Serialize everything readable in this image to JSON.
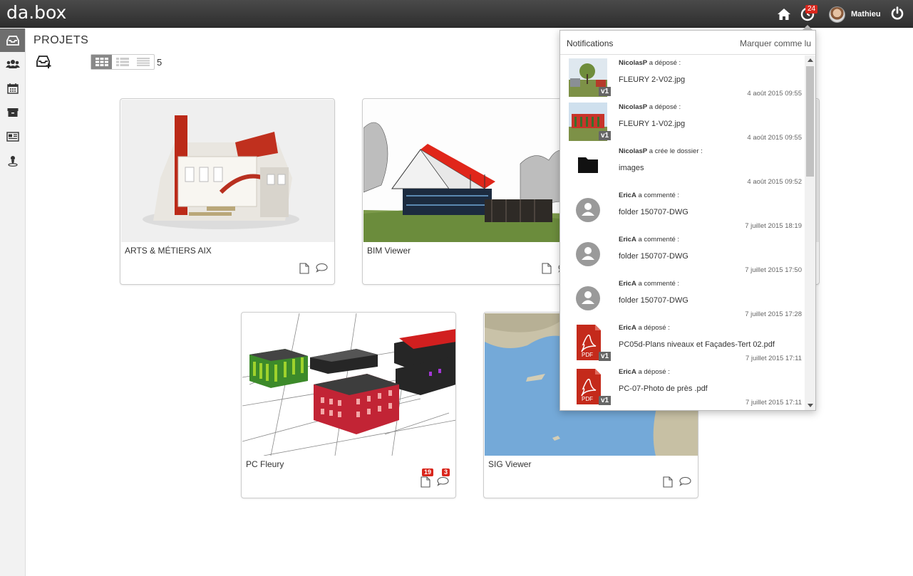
{
  "app": {
    "logo": "da.box"
  },
  "header": {
    "notif_count": "24",
    "username": "Mathieu"
  },
  "sidebar": {
    "items": [
      {
        "name": "projects-icon"
      },
      {
        "name": "users-icon"
      },
      {
        "name": "calendar-icon"
      },
      {
        "name": "archive-icon"
      },
      {
        "name": "news-icon"
      },
      {
        "name": "user-pin-icon"
      }
    ]
  },
  "page": {
    "title": "PROJETS",
    "count": "5"
  },
  "projects": [
    {
      "title": "ARTS & MÉTIERS AIX",
      "doc_badge": "",
      "comment_badge": ""
    },
    {
      "title": "BIM Viewer",
      "doc_badge": "",
      "comment_badge": ""
    },
    {
      "title": "",
      "doc_badge": "",
      "comment_badge": ""
    },
    {
      "title": "PC Fleury",
      "doc_badge": "19",
      "comment_badge": "3"
    },
    {
      "title": "SIG Viewer",
      "doc_badge": "",
      "comment_badge": ""
    }
  ],
  "notifications": {
    "title": "Notifications",
    "mark_read": "Marquer comme lu",
    "items": [
      {
        "user": "NicolasP",
        "action": "a déposé :",
        "name": "FLEURY 2-V02.jpg",
        "date": "4 août 2015 09:55",
        "thumb": "photo",
        "version": "v1"
      },
      {
        "user": "NicolasP",
        "action": "a déposé :",
        "name": "FLEURY 1-V02.jpg",
        "date": "4 août 2015 09:55",
        "thumb": "photo2",
        "version": "v1"
      },
      {
        "user": "NicolasP",
        "action": "a crée le dossier :",
        "name": "images",
        "date": "4 août 2015 09:52",
        "thumb": "folder",
        "version": ""
      },
      {
        "user": "EricA",
        "action": "a commenté :",
        "name": "folder 150707-DWG",
        "date": "7 juillet 2015 18:19",
        "thumb": "user",
        "version": ""
      },
      {
        "user": "EricA",
        "action": "a commenté :",
        "name": "folder 150707-DWG",
        "date": "7 juillet 2015 17:50",
        "thumb": "user",
        "version": ""
      },
      {
        "user": "EricA",
        "action": "a commenté :",
        "name": "folder 150707-DWG",
        "date": "7 juillet 2015 17:28",
        "thumb": "user",
        "version": ""
      },
      {
        "user": "EricA",
        "action": "a déposé :",
        "name": "PC05d-Plans niveaux et Façades-Tert 02.pdf",
        "date": "7 juillet 2015 17:11",
        "thumb": "pdf",
        "version": "v1"
      },
      {
        "user": "EricA",
        "action": "a déposé :",
        "name": "PC-07-Photo de près .pdf",
        "date": "7 juillet 2015 17:11",
        "thumb": "pdf",
        "version": "v1"
      }
    ]
  },
  "colors": {
    "badge": "#d9261c",
    "topbar": "#3a3a3a",
    "sidebar_active": "#6e6e6e"
  }
}
